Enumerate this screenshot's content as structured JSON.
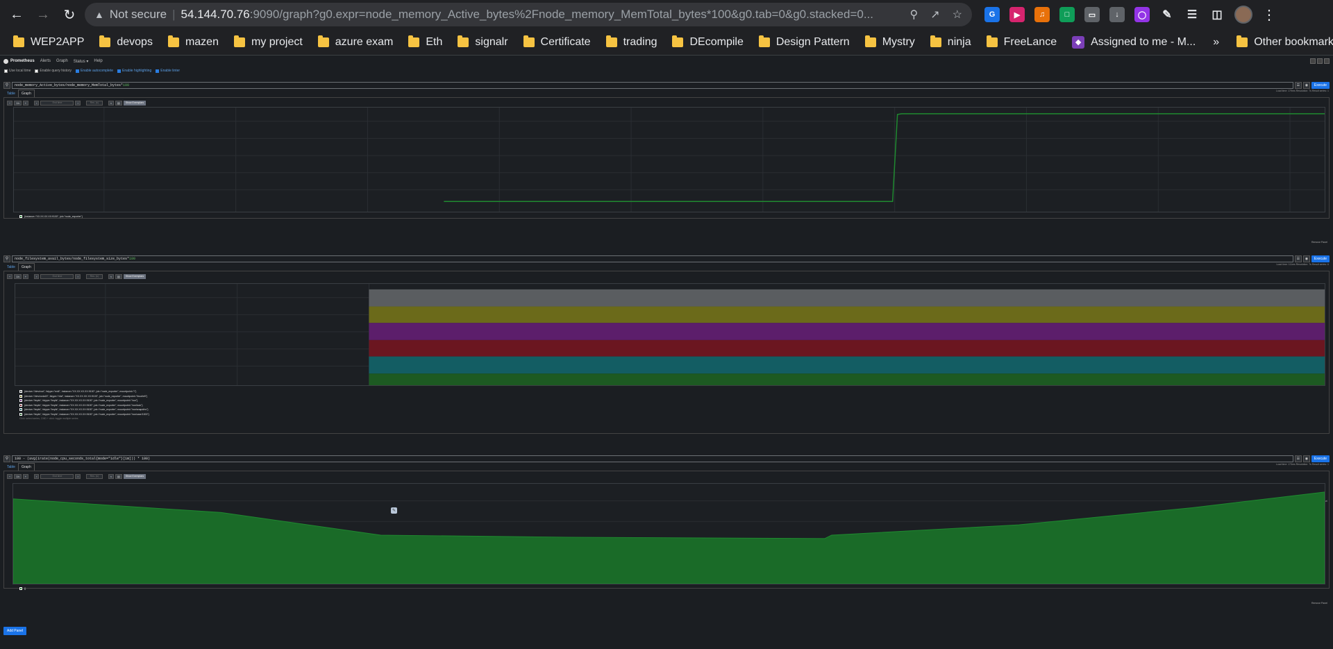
{
  "browser": {
    "security_label": "Not secure",
    "url_host": "54.144.70.76",
    "url_rest": ":9090/graph?g0.expr=node_memory_Active_bytes%2Fnode_memory_MemTotal_bytes*100&g0.tab=0&g0.stacked=0...",
    "bookmarks": [
      "WEP2APP",
      "devops",
      "mazen",
      "my project",
      "azure exam",
      "Eth",
      "signalr",
      "Certificate",
      "trading",
      "DEcompile",
      "Design Pattern",
      "Mystry",
      "ninja",
      "FreeLance",
      "Assigned to me - M..."
    ],
    "more_label": "»",
    "other_bookmarks": "Other bookmarks"
  },
  "prom": {
    "brand": "Prometheus",
    "nav": [
      "Alerts",
      "Graph",
      "Status ▾",
      "Help"
    ],
    "options": [
      {
        "label": "Use local time",
        "checked": false
      },
      {
        "label": "Enable query history",
        "checked": false
      },
      {
        "label": "Enable autocomplete",
        "checked": true
      },
      {
        "label": "Enable highlighting",
        "checked": true
      },
      {
        "label": "Enable linter",
        "checked": true
      }
    ],
    "execute": "Execute",
    "tab_table": "Table",
    "tab_graph": "Graph",
    "show_exemplars": "Show Exemplars",
    "remove_panel": "Remove Panel",
    "add_panel": "Add Panel",
    "range": "1h",
    "end_time_placeholder": "End time",
    "res_placeholder": "Res. (s)",
    "panels": [
      {
        "query_text": "node_memory_Active_bytes/node_memory_MemTotal_bytes*",
        "query_num": "100",
        "stats": "Load time: 179ms   Resolution: 7s   Result series: 1",
        "legend": [
          "{instance=\"XX.XX.XX.XX:9100\", job=\"node_exporter\"}"
        ]
      },
      {
        "query_text": "node_filesystem_avail_bytes/node_filesystem_size_bytes*",
        "query_num": "100",
        "stats": "Load time: 111ms   Resolution: 7s   Result series: 6",
        "legend": [
          "{device=\"/dev/root\", fstype=\"ext4\", instance=\"XX.XX.XX.XX:9100\", job=\"node_exporter\", mountpoint=\"/\"}",
          "{device=\"/dev/xvda15\", fstype=\"vfat\", instance=\"XX.XX.XX.XX:9100\", job=\"node_exporter\", mountpoint=\"/boot/efi\"}",
          "{device=\"tmpfs\", fstype=\"tmpfs\", instance=\"XX.XX.XX.XX:9100\", job=\"node_exporter\", mountpoint=\"/run\"}",
          "{device=\"tmpfs\", fstype=\"tmpfs\", instance=\"XX.XX.XX.XX:9100\", job=\"node_exporter\", mountpoint=\"/run/lock\"}",
          "{device=\"tmpfs\", fstype=\"tmpfs\", instance=\"XX.XX.XX.XX:9100\", job=\"node_exporter\", mountpoint=\"/run/snapd/ns\"}",
          "{device=\"tmpfs\", fstype=\"tmpfs\", instance=\"XX.XX.XX.XX:9100\", job=\"node_exporter\", mountpoint=\"/run/user/1000\"}"
        ],
        "legend_hint": "Click: select series, CMD + click: toggle multiple series"
      },
      {
        "query_text": "100 - (avg(irate(node_cpu_seconds_total{mode=\"idle\"}[1m])) * 100)",
        "stats": "Load time: 173ms   Resolution: 7s   Result series: 1",
        "legend": [
          "{}"
        ]
      }
    ]
  },
  "colors": {
    "accent": "#1a73e8",
    "series_green": "#1f7a2b",
    "fs_bands": [
      "#5a5d60",
      "#6b6a1a",
      "#5c1e6b",
      "#6b1620",
      "#135d63",
      "#1d5a22"
    ]
  }
}
